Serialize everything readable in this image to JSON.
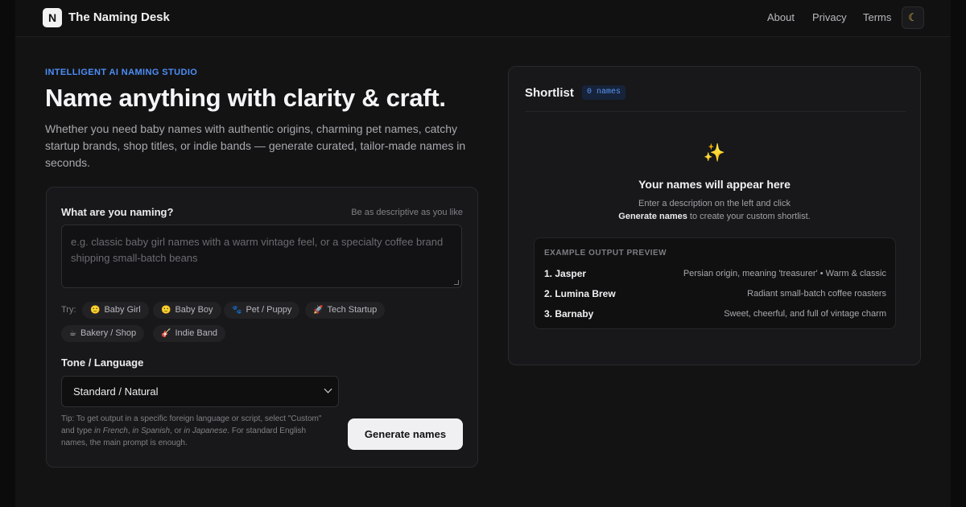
{
  "header": {
    "logo_letter": "N",
    "brand": "The Naming Desk",
    "nav": [
      "About",
      "Privacy",
      "Terms"
    ],
    "theme_icon": "moon-icon"
  },
  "hero": {
    "eyebrow": "INTELLIGENT AI NAMING STUDIO",
    "title": "Name anything with clarity & craft.",
    "subtitle": "Whether you need baby names with authentic origins, charming pet names, catchy startup brands, shop titles, or indie bands — generate curated, tailor-made names in seconds."
  },
  "form": {
    "naming_label": "What are you naming?",
    "naming_hint": "Be as descriptive as you like",
    "textarea_value": "",
    "textarea_placeholder": "e.g. classic baby girl names with a warm vintage feel, or a specialty coffee brand shipping small-batch beans",
    "try_label": "Try:",
    "chips": [
      {
        "icon": "🙂",
        "label": "Baby Girl"
      },
      {
        "icon": "🙂",
        "label": "Baby Boy"
      },
      {
        "icon": "🐾",
        "label": "Pet / Puppy"
      },
      {
        "icon": "🚀",
        "label": "Tech Startup"
      },
      {
        "icon": "☕",
        "label": "Bakery / Shop"
      },
      {
        "icon": "🎸",
        "label": "Indie Band"
      }
    ],
    "tone_label": "Tone / Language",
    "tone_selected": "Standard / Natural",
    "tip_parts": {
      "a": "Tip: To get output in a specific foreign language or script, select \"Custom\" and type ",
      "i1": "in French",
      "c1": ", ",
      "i2": "in Spanish",
      "c2": ", or ",
      "i3": "in Japanese",
      "b": ". For standard English names, the main prompt is enough."
    },
    "generate_label": "Generate names"
  },
  "shortlist": {
    "title": "Shortlist",
    "count": "0 names",
    "sparkle": "✨",
    "empty_title": "Your names will appear here",
    "empty_line1": "Enter a description on the left and click",
    "empty_bold": "Generate names",
    "empty_line2": " to create your custom shortlist.",
    "example_heading": "EXAMPLE OUTPUT PREVIEW",
    "examples": [
      {
        "name": "1. Jasper",
        "meta": "Persian origin, meaning 'treasurer' • Warm & classic"
      },
      {
        "name": "2. Lumina Brew",
        "meta": "Radiant small-batch coffee roasters"
      },
      {
        "name": "3. Barnaby",
        "meta": "Sweet, cheerful, and full of vintage charm"
      }
    ]
  }
}
